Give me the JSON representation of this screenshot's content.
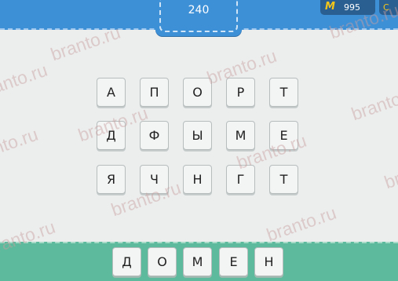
{
  "header": {
    "level": "240",
    "coins_icon": "М",
    "coins": "995",
    "extra_icon": "C"
  },
  "grid": [
    [
      "А",
      "П",
      "О",
      "Р",
      "Т"
    ],
    [
      "Д",
      "Ф",
      "Ы",
      "М",
      "Е"
    ],
    [
      "Я",
      "Ч",
      "Н",
      "Г",
      "Т"
    ]
  ],
  "answer": [
    "Д",
    "О",
    "М",
    "Е",
    "Н"
  ],
  "watermark": "branto.ru",
  "colors": {
    "header": "#3d8fd6",
    "footer": "#5dba9c",
    "coin": "#f6c718"
  }
}
